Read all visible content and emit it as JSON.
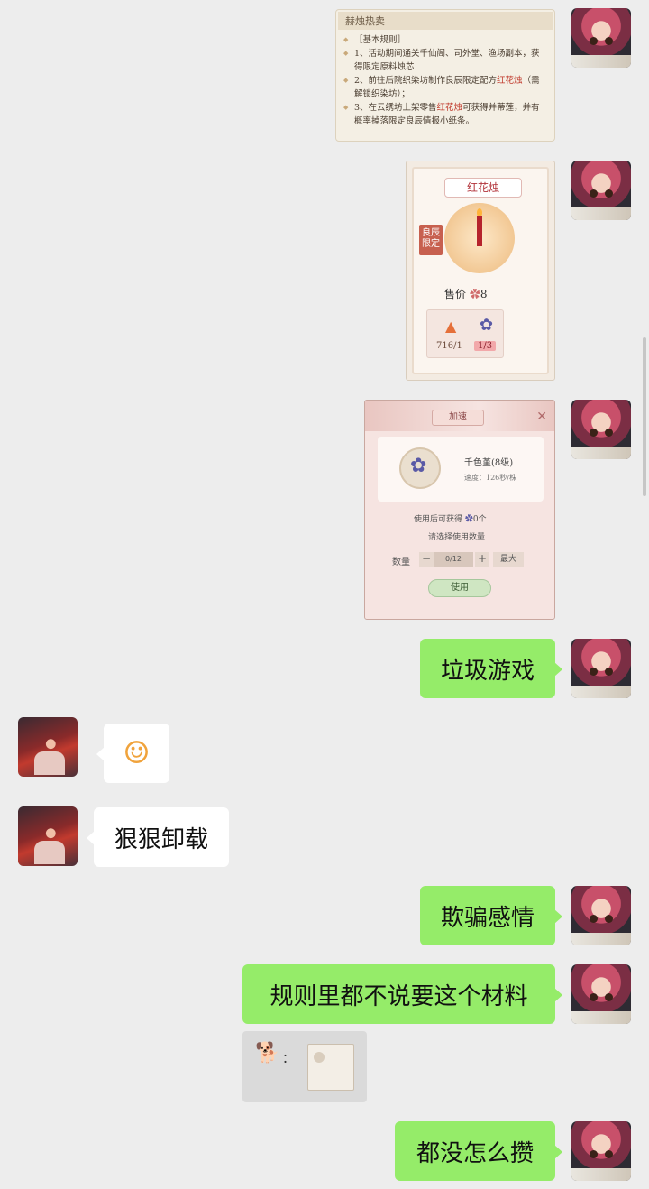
{
  "messages": {
    "rules_card": {
      "title": "赫烛热卖",
      "section": "［基本规则］",
      "line1": "1、活动期间通关千仙阁、司外堂、渔场副本，获得限定原料烛芯",
      "line2_a": "2、前往后院织染坊制作良辰限定配方",
      "line2_hl": "红花烛",
      "line2_b": "（需解锁织染坊）；",
      "line3_a": "3、在云绣坊上架零售",
      "line3_hl": "红花烛",
      "line3_b": "可获得并蒂莲，并有概率掉落限定良辰情报小纸条。"
    },
    "candle_card": {
      "title": "红花烛",
      "tag": "良辰限定",
      "price_label": "售价",
      "price_value": "8",
      "mat1": "716/1",
      "mat2": "1/3"
    },
    "speed_card": {
      "title": "加速",
      "close": "✕",
      "item_name": "千色堇(8级)",
      "speed": "速度：126秒/株",
      "get_text": "使用后可获得",
      "get_count": "0个",
      "choose_text": "请选择使用数量",
      "qty_label": "数量",
      "minus": "−",
      "count": "0/12",
      "plus": "+",
      "max": "最大",
      "use": "使用"
    },
    "m4": "垃圾游戏",
    "m5_emoji": "dog-face-emoji",
    "m6": "狠狠卸载",
    "m7": "欺骗感情",
    "m8": "规则里都不说要这个材料",
    "quote": {
      "colon": "："
    },
    "m9": "都没怎么攒"
  },
  "colors": {
    "background": "#ededed",
    "my_bubble": "#95ec69",
    "their_bubble": "#ffffff"
  }
}
